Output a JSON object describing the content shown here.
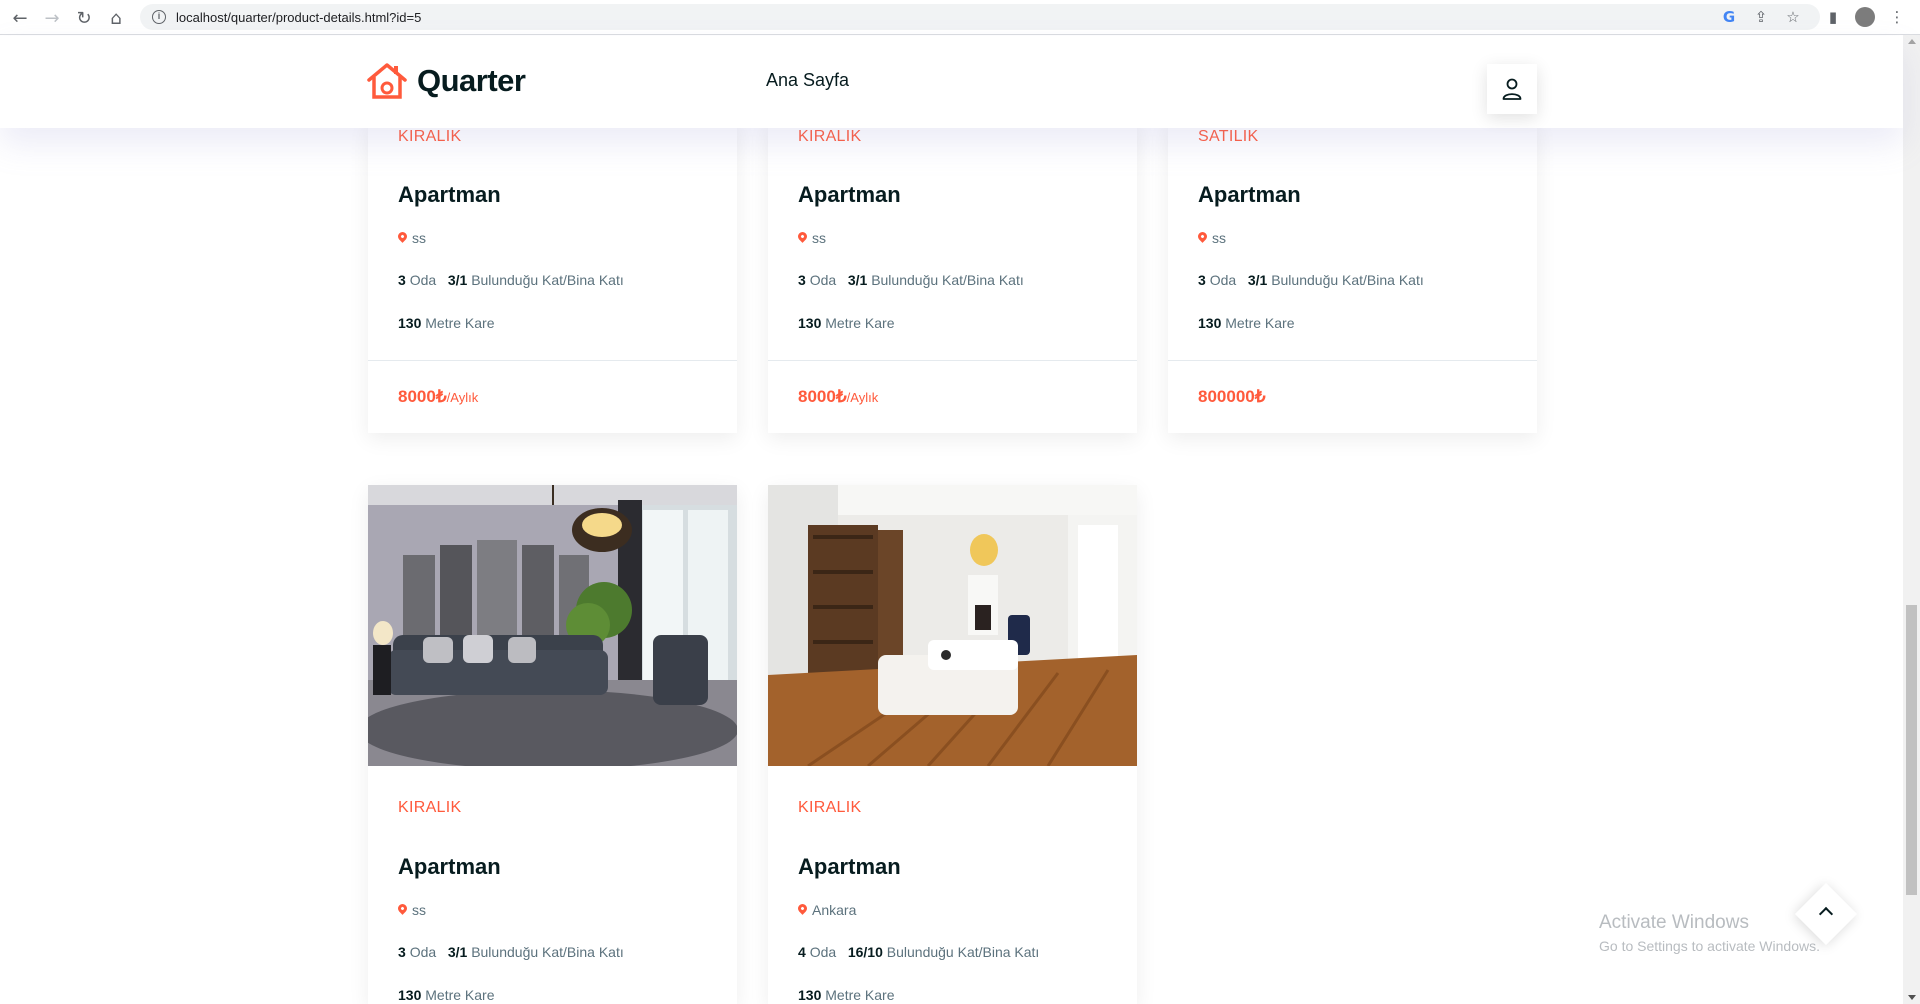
{
  "browser": {
    "url": "localhost/quarter/product-details.html?id=5"
  },
  "header": {
    "logo_text": "Quarter",
    "nav_home": "Ana Sayfa"
  },
  "cards_top": [
    {
      "status": "KIRALIK",
      "title": "Apartman",
      "location": "ss",
      "rooms": "3",
      "rooms_unit": "Oda",
      "floor": "3/1",
      "floor_unit": "Bulunduğu Kat/Bina Katı",
      "area": "130",
      "area_unit": "Metre Kare",
      "price": "8000₺",
      "price_suffix": "/Aylık"
    },
    {
      "status": "KIRALIK",
      "title": "Apartman",
      "location": "ss",
      "rooms": "3",
      "rooms_unit": "Oda",
      "floor": "3/1",
      "floor_unit": "Bulunduğu Kat/Bina Katı",
      "area": "130",
      "area_unit": "Metre Kare",
      "price": "8000₺",
      "price_suffix": "/Aylık"
    },
    {
      "status": "SATILIK",
      "title": "Apartman",
      "location": "ss",
      "rooms": "3",
      "rooms_unit": "Oda",
      "floor": "3/1",
      "floor_unit": "Bulunduğu Kat/Bina Katı",
      "area": "130",
      "area_unit": "Metre Kare",
      "price": "800000₺",
      "price_suffix": ""
    }
  ],
  "cards_bottom": [
    {
      "status": "KIRALIK",
      "title": "Apartman",
      "location": "ss",
      "rooms": "3",
      "rooms_unit": "Oda",
      "floor": "3/1",
      "floor_unit": "Bulunduğu Kat/Bina Katı",
      "area": "130",
      "area_unit": "Metre Kare"
    },
    {
      "status": "KIRALIK",
      "title": "Apartman",
      "location": "Ankara",
      "rooms": "4",
      "rooms_unit": "Oda",
      "floor": "16/10",
      "floor_unit": "Bulunduğu Kat/Bina Katı",
      "area": "130",
      "area_unit": "Metre Kare"
    }
  ],
  "watermark": {
    "line1": "Activate Windows",
    "line2": "Go to Settings to activate Windows."
  },
  "colors": {
    "accent": "#ff5a3c",
    "heading": "#071c1f",
    "text": "#5c727d"
  }
}
